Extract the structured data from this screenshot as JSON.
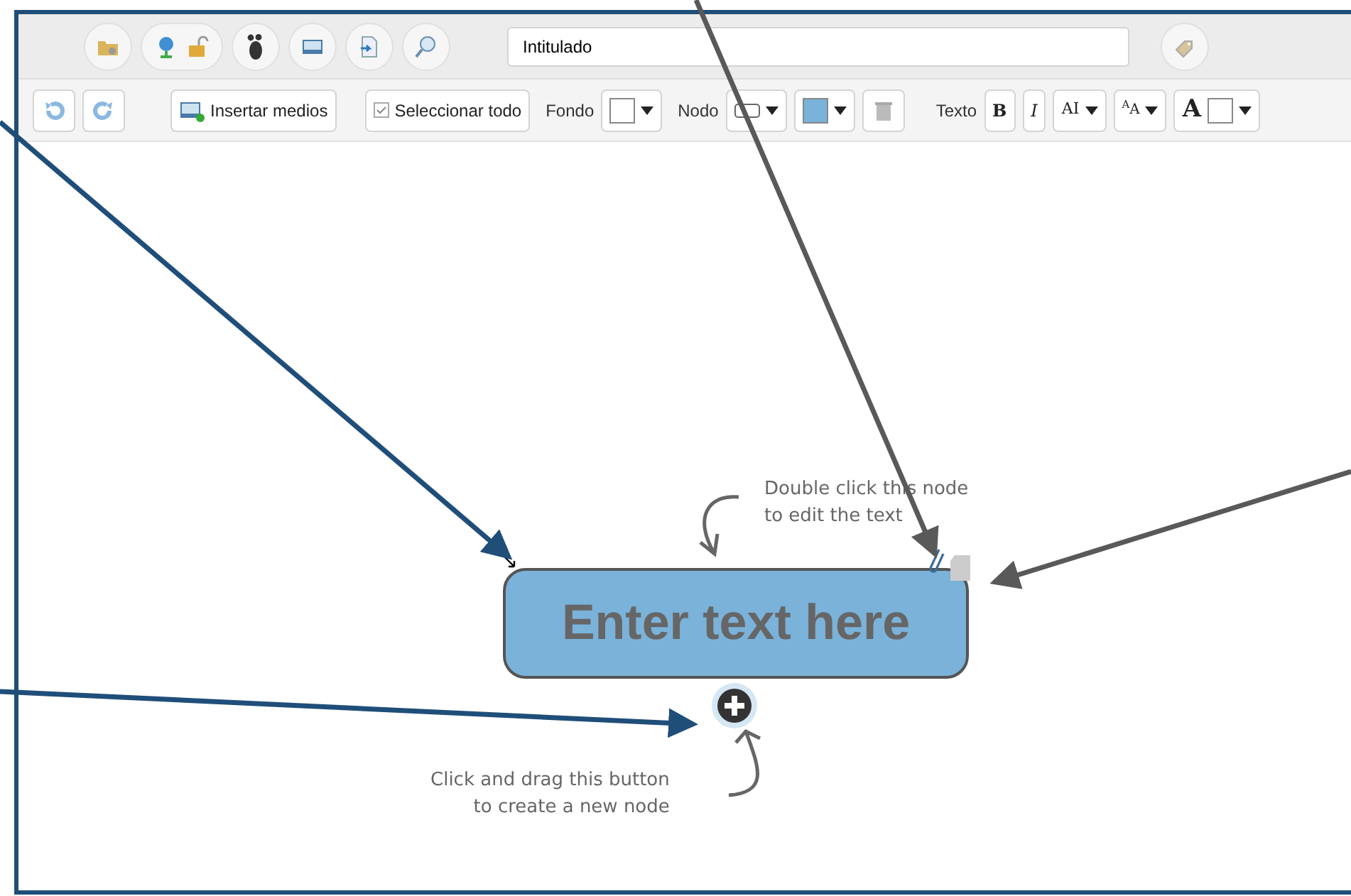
{
  "title_field": {
    "value": "Intitulado"
  },
  "toolbar": {
    "media_button": "Insertar medios",
    "select_all": {
      "label": "Seleccionar todo",
      "checked": true
    },
    "background_label": "Fondo",
    "node_label": "Nodo",
    "text_label": "Texto",
    "bold": "B",
    "italic": "I",
    "font_button": "AI",
    "size_button": "$^{A}$A",
    "color_button": "A"
  },
  "node": {
    "text": "Enter text here"
  },
  "hints": [
    {
      "lines": [
        "Double click this node",
        "to edit the text"
      ]
    },
    {
      "lines": [
        "Click and drag this button",
        "to create a new node"
      ]
    }
  ]
}
